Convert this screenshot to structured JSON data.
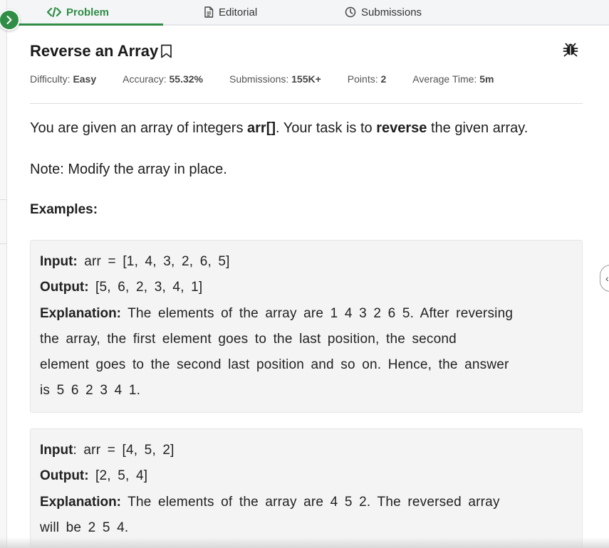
{
  "tabs": [
    {
      "label": "Problem",
      "icon": "code-icon"
    },
    {
      "label": "Editorial",
      "icon": "document-icon"
    },
    {
      "label": "Submissions",
      "icon": "clock-icon"
    }
  ],
  "accent_color": "#2f8d46",
  "problem": {
    "title": "Reverse an Array",
    "meta": [
      {
        "label": "Difficulty:",
        "value": "Easy"
      },
      {
        "label": "Accuracy:",
        "value": "55.32%"
      },
      {
        "label": "Submissions:",
        "value": "155K+"
      },
      {
        "label": "Points:",
        "value": "2"
      },
      {
        "label": "Average Time:",
        "value": "5m"
      }
    ],
    "statement": {
      "part1": "You are given an array of integers ",
      "arr": "arr[]",
      "part2": ". Your task is to ",
      "reverse": "reverse",
      "part3": " the given array."
    },
    "note": "Note: Modify the array in place.",
    "examples_heading": "Examples:",
    "examples": [
      {
        "input_label": "Input:",
        "input_value": " arr = [1, 4, 3, 2, 6, 5]",
        "output_label": "Output:",
        "output_value": " [5, 6, 2, 3, 4, 1]",
        "explanation_label": "Explanation:",
        "explanation_lines": [
          " The elements of the array are 1 4 3 2 6 5. After reversing",
          "the array, the first element goes to the last position, the second",
          "element goes to the second last position and so on. Hence, the answer",
          "is 5 6 2 3 4 1."
        ]
      },
      {
        "input_label": "Input",
        "input_value": ": arr = [4, 5, 2]",
        "output_label": "Output:",
        "output_value": " [2, 5, 4]",
        "explanation_label": "Explanation:",
        "explanation_lines": [
          " The elements of the array are 4 5 2. The reversed array",
          "will be 2 5 4."
        ]
      }
    ]
  }
}
